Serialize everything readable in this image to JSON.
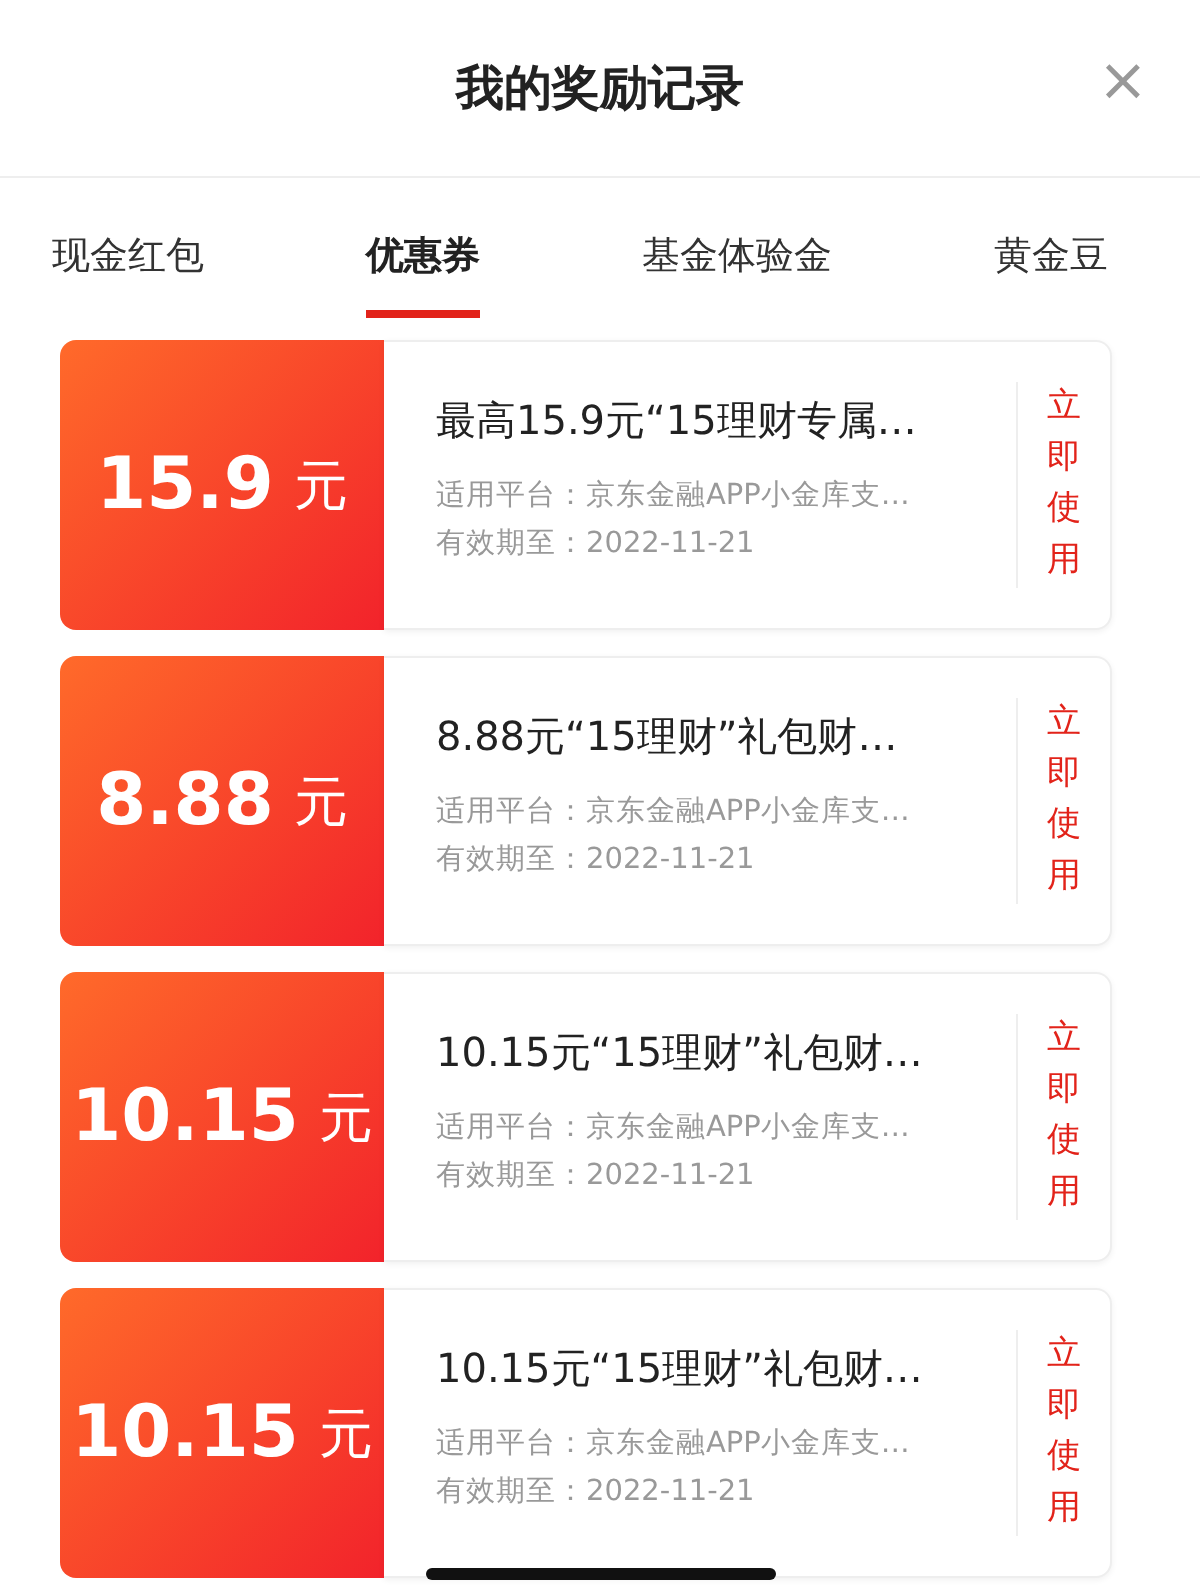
{
  "header": {
    "title": "我的奖励记录",
    "close": "×"
  },
  "tabs": [
    {
      "label": "现金红包",
      "selected": false
    },
    {
      "label": "优惠券",
      "selected": true
    },
    {
      "label": "基金体验金",
      "selected": false
    },
    {
      "label": "黄金豆",
      "selected": false
    }
  ],
  "coupons": [
    {
      "amount": "15.9",
      "unit": "元",
      "title": "最高15.9元“15理财专属…",
      "platform": "适用平台：京东金融APP小金库支…",
      "expiry": "有效期至：2022-11-21",
      "action": "立即使用"
    },
    {
      "amount": "8.88",
      "unit": "元",
      "title": "8.88元“15理财”礼包财…",
      "platform": "适用平台：京东金融APP小金库支…",
      "expiry": "有效期至：2022-11-21",
      "action": "立即使用"
    },
    {
      "amount": "10.15",
      "unit": "元",
      "title": "10.15元“15理财”礼包财…",
      "platform": "适用平台：京东金融APP小金库支…",
      "expiry": "有效期至：2022-11-21",
      "action": "立即使用"
    },
    {
      "amount": "10.15",
      "unit": "元",
      "title": "10.15元“15理财”礼包财…",
      "platform": "适用平台：京东金融APP小金库支…",
      "expiry": "有效期至：2022-11-21",
      "action": "立即使用"
    }
  ]
}
